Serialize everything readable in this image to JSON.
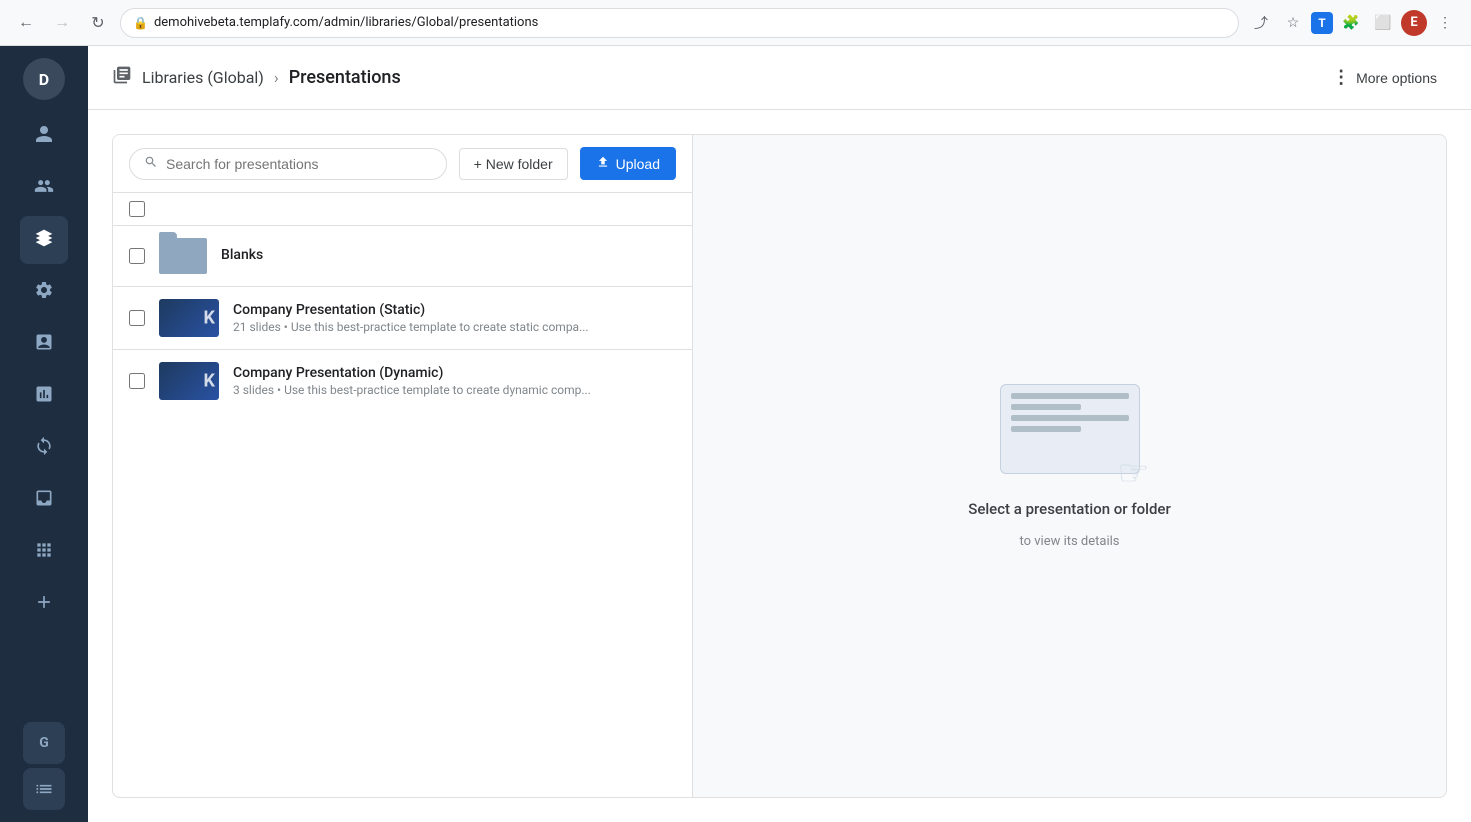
{
  "browser": {
    "url": "demohivebeta.templafy.com/admin/libraries/Global/presentations",
    "back_disabled": false,
    "forward_disabled": true
  },
  "header": {
    "breadcrumb_icon": "☰",
    "libraries_label": "Libraries (Global)",
    "separator": "›",
    "page_title": "Presentations",
    "more_options_label": "More options"
  },
  "toolbar": {
    "search_placeholder": "Search for presentations",
    "new_folder_label": "+ New folder",
    "upload_label": "Upload"
  },
  "list": {
    "items": [
      {
        "type": "folder",
        "name": "Blanks",
        "meta": ""
      },
      {
        "type": "presentation",
        "name": "Company Presentation (Static)",
        "meta": "21 slides  •  Use this best-practice template to create static compa..."
      },
      {
        "type": "presentation",
        "name": "Company Presentation (Dynamic)",
        "meta": "3 slides  •  Use this best-practice template to create dynamic comp..."
      }
    ]
  },
  "detail_panel": {
    "title": "Select a presentation or folder",
    "subtitle": "to view its details"
  },
  "sidebar": {
    "top_avatar": "D",
    "items": [
      {
        "id": "user-icon",
        "symbol": "👤"
      },
      {
        "id": "team-icon",
        "symbol": "👥"
      },
      {
        "id": "layers-icon",
        "symbol": "▤"
      },
      {
        "id": "settings-icon",
        "symbol": "⚙"
      },
      {
        "id": "chart-icon",
        "symbol": "📊"
      },
      {
        "id": "analytics-icon",
        "symbol": "◎"
      },
      {
        "id": "inbox-icon",
        "symbol": "📥"
      },
      {
        "id": "grid-icon",
        "symbol": "▦"
      },
      {
        "id": "plus-icon",
        "symbol": "✚"
      }
    ],
    "bottom_g": "G",
    "bottom_list": "≡"
  }
}
